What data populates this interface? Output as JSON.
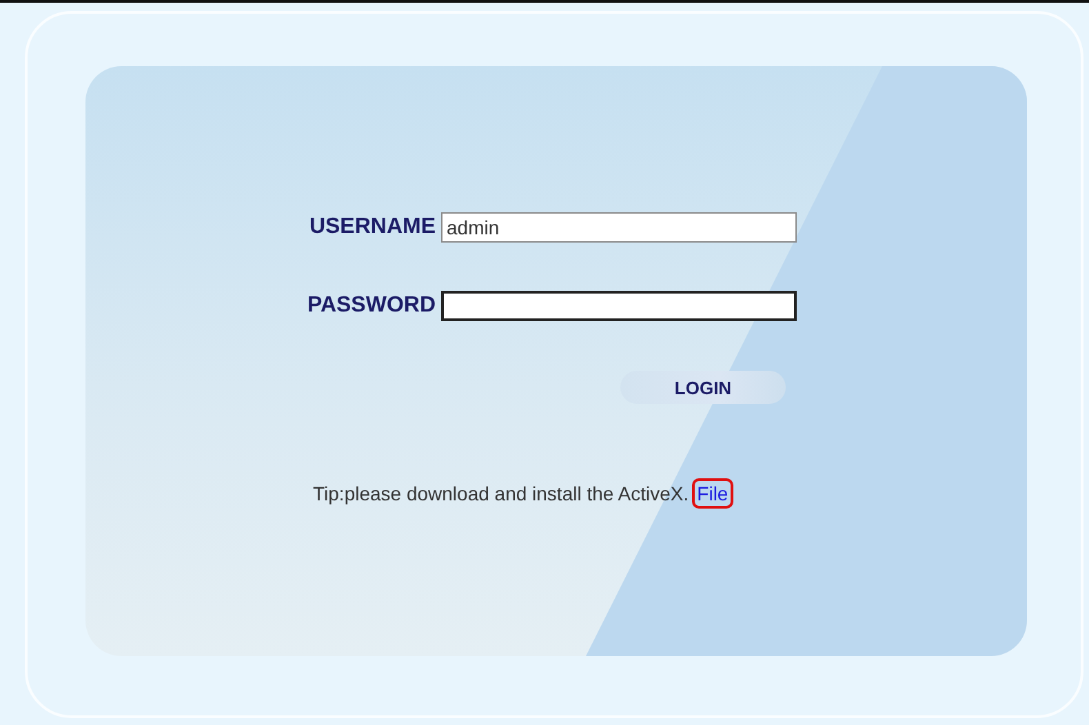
{
  "login_form": {
    "username": {
      "label": "USERNAME",
      "value": "admin"
    },
    "password": {
      "label": "PASSWORD"
    },
    "login_button": "LOGIN",
    "tip": {
      "text": "Tip:please download and install the ActiveX.",
      "link": "File",
      "highlighted": true
    }
  }
}
